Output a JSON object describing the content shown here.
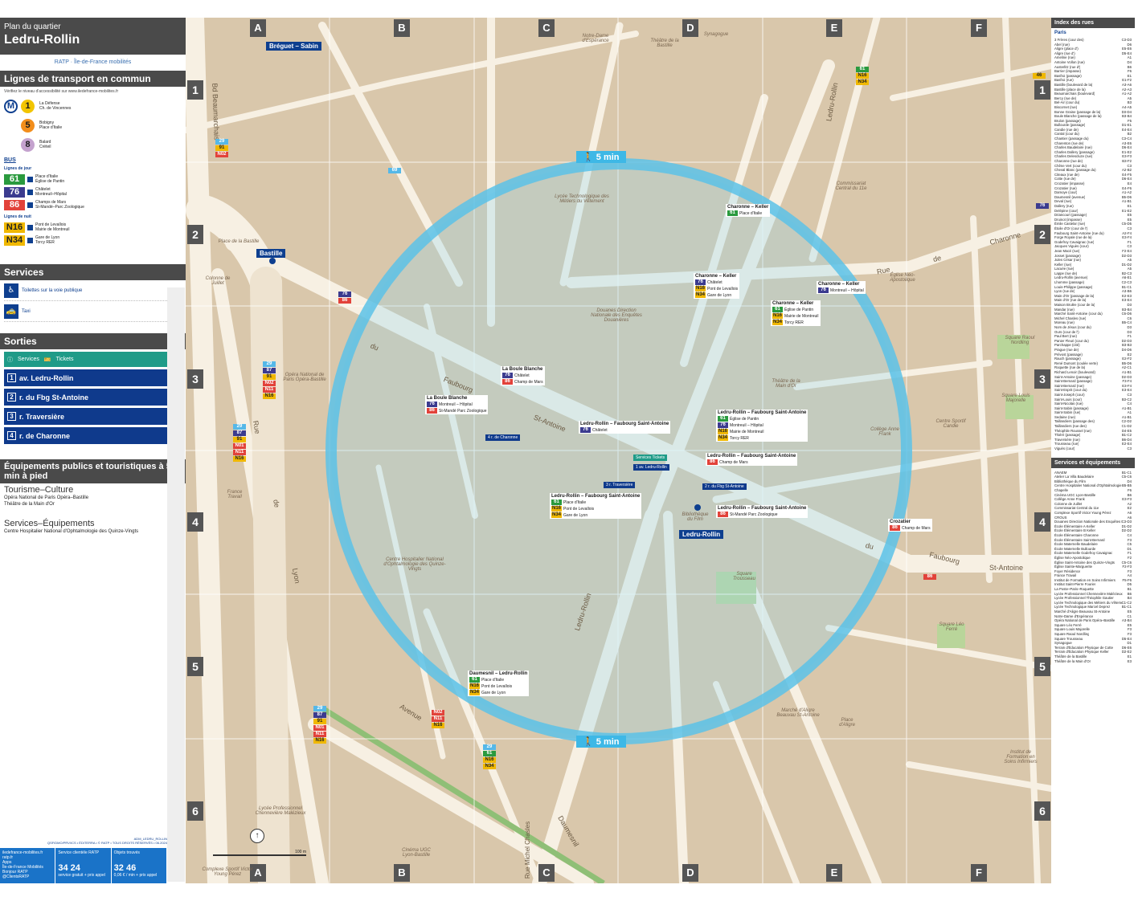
{
  "header": {
    "subtitle": "Plan du quartier",
    "title": "Ledru-Rollin",
    "logos": "RATP · Île-de-France mobilités"
  },
  "transport": {
    "heading": "Lignes de transport en commun",
    "note": "Vérifiez le niveau d'accessibilité sur www.iledefrance-mobilites.fr",
    "metro": [
      {
        "line": "1",
        "color": "#f2c500",
        "dest": [
          "La Défense",
          "Ch. de Vincennes"
        ]
      },
      {
        "line": "5",
        "color": "#f28e1c",
        "dest": [
          "Bobigny",
          "Place d'Italie"
        ]
      },
      {
        "line": "8",
        "color": "#c4a2ce",
        "dest": [
          "Balard",
          "Créteil"
        ]
      }
    ],
    "bus_label": "BUS",
    "day_label": "Lignes de jour",
    "day": [
      {
        "line": "61",
        "color": "#2a9a3e",
        "dest": [
          "Place d'Italie",
          "Église de Pantin"
        ]
      },
      {
        "line": "76",
        "color": "#3b3b8f",
        "dest": [
          "Châtelet",
          "Montreuil–Hôpital"
        ]
      },
      {
        "line": "86",
        "color": "#e2423a",
        "dest": [
          "Champs de Mars",
          "St-Mandé–Parc Zoologique"
        ]
      }
    ],
    "night_label": "Lignes de nuit",
    "night": [
      {
        "line": "N16",
        "color": "#f0b800",
        "dest": [
          "Pont de Levallois",
          "Mairie de Montreuil"
        ]
      },
      {
        "line": "N34",
        "color": "#f0b800",
        "dest": [
          "Gare de Lyon",
          "Torcy RER"
        ]
      }
    ]
  },
  "services": {
    "heading": "Services",
    "items": [
      {
        "label": "Toilettes sur la voie publique",
        "ref": ""
      },
      {
        "label": "Taxi",
        "ref": "A2"
      }
    ]
  },
  "exits": {
    "heading": "Sorties",
    "services_label": "Services",
    "tickets_label": "Tickets",
    "items": [
      {
        "num": "1",
        "label": "av. Ledru-Rollin"
      },
      {
        "num": "2",
        "label": "r. du Fbg St-Antoine"
      },
      {
        "num": "3",
        "label": "r. Traversière"
      },
      {
        "num": "4",
        "label": "r. de Charonne"
      }
    ]
  },
  "equipment": {
    "heading": "Équipements publics et touristiques à 5 min à pied",
    "groups": [
      {
        "title": "Tourisme–Culture",
        "items": [
          "Opéra National de Paris Opéra–Bastille",
          "Théâtre de la Main d'Or"
        ]
      },
      {
        "title": "Services–Équipements",
        "items": [
          "Centre Hospitalier National d'Ophtalmologie des Quinze-Vingts"
        ]
      }
    ]
  },
  "credits": {
    "code": "ADM_LEDRU_ROLLIN",
    "line": "QSF/DMO/PRV/ICS • ÉDITERRA • © RATP • TOUS DROITS RÉSERVÉS • 06.2024"
  },
  "contact": {
    "web": [
      "iledefrance-mobilites.fr",
      "ratp.fr",
      "Apps",
      "Île-de-France Mobilités",
      "Bonjour RATP",
      "@ClientsRATP"
    ],
    "svc_title": "Service clientèle RATP",
    "svc_phone": "34 24",
    "svc_note": "service gratuit + prix appel",
    "lost_title": "Objets trouvés",
    "lost_phone": "32 46",
    "lost_note": "0,06 € / min + prix appel"
  },
  "map": {
    "columns": [
      "A",
      "B",
      "C",
      "D",
      "E",
      "F"
    ],
    "rows": [
      "1",
      "2",
      "3",
      "4",
      "5",
      "6"
    ],
    "walk_label": "5 min",
    "stations": [
      "Bréguet – Sabin",
      "Bastille",
      "Ledru-Rollin"
    ],
    "stops": [
      {
        "name": "Charonne – Keller",
        "lines": [
          {
            "n": "61",
            "c": "#2a9a3e",
            "d": "Place d'Italie"
          }
        ]
      },
      {
        "name": "Charonne – Keller",
        "lines": [
          {
            "n": "76",
            "c": "#3b3b8f",
            "d": "Châtelet"
          },
          {
            "n": "N16",
            "c": "#f0b800",
            "d": "Pont de Levallois"
          },
          {
            "n": "N34",
            "c": "#f0b800",
            "d": "Gare de Lyon"
          }
        ]
      },
      {
        "name": "Charonne – Keller",
        "lines": [
          {
            "n": "61",
            "c": "#2a9a3e",
            "d": "Église de Pantin"
          },
          {
            "n": "N16",
            "c": "#f0b800",
            "d": "Mairie de Montreuil"
          },
          {
            "n": "N34",
            "c": "#f0b800",
            "d": "Torcy RER"
          }
        ]
      },
      {
        "name": "Charonne – Keller",
        "lines": [
          {
            "n": "76",
            "c": "#3b3b8f",
            "d": "Montreuil – Hôpital"
          }
        ]
      },
      {
        "name": "La Boule Blanche",
        "lines": [
          {
            "n": "76",
            "c": "#3b3b8f",
            "d": "Châtelet"
          },
          {
            "n": "86",
            "c": "#e2423a",
            "d": "Champ de Mars"
          }
        ]
      },
      {
        "name": "La Boule Blanche",
        "lines": [
          {
            "n": "76",
            "c": "#3b3b8f",
            "d": "Montreuil – Hôpital"
          },
          {
            "n": "86",
            "c": "#e2423a",
            "d": "St-Mandé Parc Zoologique"
          }
        ]
      },
      {
        "name": "Ledru-Rollin – Faubourg Saint-Antoine",
        "lines": [
          {
            "n": "76",
            "c": "#3b3b8f",
            "d": "Châtelet"
          }
        ]
      },
      {
        "name": "Ledru-Rollin – Faubourg Saint-Antoine",
        "lines": [
          {
            "n": "61",
            "c": "#2a9a3e",
            "d": "Église de Pantin"
          },
          {
            "n": "76",
            "c": "#3b3b8f",
            "d": "Montreuil – Hôpital"
          },
          {
            "n": "N16",
            "c": "#f0b800",
            "d": "Mairie de Montreuil"
          },
          {
            "n": "N34",
            "c": "#f0b800",
            "d": "Torcy RER"
          }
        ]
      },
      {
        "name": "Ledru-Rollin – Faubourg Saint-Antoine",
        "lines": [
          {
            "n": "86",
            "c": "#e2423a",
            "d": "Champ de Mars"
          }
        ]
      },
      {
        "name": "Ledru-Rollin – Faubourg Saint-Antoine",
        "lines": [
          {
            "n": "61",
            "c": "#2a9a3e",
            "d": "Place d'Italie"
          },
          {
            "n": "N16",
            "c": "#f0b800",
            "d": "Pont de Levallois"
          },
          {
            "n": "N34",
            "c": "#f0b800",
            "d": "Gare de Lyon"
          }
        ]
      },
      {
        "name": "Ledru-Rollin – Faubourg Saint-Antoine",
        "lines": [
          {
            "n": "86",
            "c": "#e2423a",
            "d": "St-Mandé Parc Zoologique"
          }
        ]
      },
      {
        "name": "Crozatier",
        "lines": [
          {
            "n": "86",
            "c": "#e2423a",
            "d": "Champ de Mars"
          }
        ]
      },
      {
        "name": "Daumesnil – Ledru-Rollin",
        "lines": [
          {
            "n": "61",
            "c": "#2a9a3e",
            "d": "Place d'Italie"
          },
          {
            "n": "N16",
            "c": "#f0b800",
            "d": "Pont de Levallois"
          },
          {
            "n": "N34",
            "c": "#f0b800",
            "d": "Gare de Lyon"
          }
        ]
      }
    ],
    "exit_tags": [
      "4 r. de Charonne",
      "1 av. Ledru-Rollin",
      "3 r. Traversière",
      "2 r. du Fbg St-Antoine"
    ],
    "exit_services": "Services  Tickets",
    "streets": [
      "Bd Beaumarchais",
      "Faubourg",
      "St-Antoine",
      "du",
      "Rue",
      "de",
      "Lyon",
      "Ledru-Rollin",
      "Avenue",
      "Daumesnil",
      "Charonne",
      "Rue",
      "de",
      "Faubourg",
      "du",
      "St-Antoine",
      "Rue Michel Chasles",
      "Ledru-Rollin"
    ],
    "places": [
      "Place de la Bastille",
      "Colonne de Juillet",
      "Opéra National de Paris Opéra-Bastille",
      "Lycée Technologique des Métiers du Vêtement",
      "Centre Hospitalier National d'Ophtalmologie des Quinze-Vingts",
      "Square Trousseau",
      "Marché d'Aligre Beauvau St-Antoine",
      "Place d'Aligre",
      "Square Léo Ferré",
      "Collège Anne Frank",
      "Théâtre de la Main d'Or",
      "Église Néo-Apostolique",
      "Douanes Direction Nationale des Enquêtes Douanières",
      "Bibliothèque du Film",
      "Lycée Professionnel Chennevière Malézieux",
      "Cinéma UGC Lyon-Bastille",
      "Complexe Sportif Victor Young Pérez",
      "Square Raoul Nordling",
      "Square Louis Majorelle",
      "Centre Sportif Candie",
      "Commissariat Central du 11e",
      "Théâtre de la Bastille",
      "Synagogue",
      "Notre-Dame d'Espérance",
      "Institut de Formation en Soins Infirmiers",
      "France Travail"
    ],
    "margin_buses": [
      {
        "n": "29",
        "c": "#55b8e8"
      },
      {
        "n": "91",
        "c": "#f0b800"
      },
      {
        "n": "N02",
        "c": "#e2423a"
      },
      {
        "n": "69",
        "c": "#55b8e8"
      },
      {
        "n": "46",
        "c": "#f0b800"
      },
      {
        "n": "61",
        "c": "#2a9a3e"
      },
      {
        "n": "N16",
        "c": "#f0b800"
      },
      {
        "n": "N34",
        "c": "#f0b800"
      },
      {
        "n": "76",
        "c": "#3b3b8f"
      },
      {
        "n": "86",
        "c": "#e2423a"
      },
      {
        "n": "87",
        "c": "#3b3b8f"
      },
      {
        "n": "N01",
        "c": "#e2423a"
      },
      {
        "n": "N11",
        "c": "#e2423a"
      }
    ],
    "scale": "100 m"
  },
  "index": {
    "heading": "Index des rues",
    "city": "Paris",
    "streets": [
      [
        "3 Frères (cour des)",
        "C3-D3"
      ],
      [
        "Abel (rue)",
        "D6"
      ],
      [
        "Aligre (place d')",
        "E5-E6"
      ],
      [
        "Aligre (rue d')",
        "D5-E4"
      ],
      [
        "Ameline (rue)",
        "A1"
      ],
      [
        "Antoine Vollon (rue)",
        "D4"
      ],
      [
        "Austerlitz (rue d')",
        "B6"
      ],
      [
        "Barrier (impasse)",
        "F6"
      ],
      [
        "Basfroi (passage)",
        "E1"
      ],
      [
        "Basfroi (rue)",
        "E1-F2"
      ],
      [
        "Bastille (boulevard de la)",
        "A3-A6"
      ],
      [
        "Bastille (place de la)",
        "A2-A3"
      ],
      [
        "Beaumarchais (boulevard)",
        "A1-A2"
      ],
      [
        "Bercy (rue de)",
        "A5"
      ],
      [
        "Bel-Air (cour du)",
        "B3"
      ],
      [
        "Biscornet (rue)",
        "A4-A5"
      ],
      [
        "Bonne Graine (passage de la)",
        "D3-D4"
      ],
      [
        "Boule Blanche (passage de la)",
        "B3-B4"
      ],
      [
        "Brulon (passage)",
        "F5"
      ],
      [
        "Bullourde (passage)",
        "D1-E1"
      ],
      [
        "Candie (rue de)",
        "E4-E4"
      ],
      [
        "Cantal (cour du)",
        "B2"
      ],
      [
        "Chantier (passage du)",
        "C3-C4"
      ],
      [
        "Charenton (rue de)",
        "A3-E6"
      ],
      [
        "Charles Baudelaire (rue)",
        "D6-E4"
      ],
      [
        "Charles Dallery (passage)",
        "E1-E2"
      ],
      [
        "Charles Delescluze (rue)",
        "E3-F3"
      ],
      [
        "Charonne (rue de)",
        "B3-F2"
      ],
      [
        "Chêne Vert (cour du)",
        "C3"
      ],
      [
        "Cheval Blanc (passage du)",
        "A2-B2"
      ],
      [
        "Citeaux (rue de)",
        "E4-F5"
      ],
      [
        "Cotte (rue de)",
        "D6-E4"
      ],
      [
        "Crozatier (impasse)",
        "E4"
      ],
      [
        "Crozatier (rue)",
        "E4-F6"
      ],
      [
        "Damoye (cour)",
        "A1-A2"
      ],
      [
        "Daumesnil (avenue)",
        "B5-D6"
      ],
      [
        "Deval (rue)",
        "A1-B1"
      ],
      [
        "Dallery (rue)",
        "E1"
      ],
      [
        "Delépine (cour)",
        "E1-E2"
      ],
      [
        "Driancourt (passage)",
        "E5"
      ],
      [
        "Druinot (impasse)",
        "E5"
      ],
      [
        "Émile Castelar (rue)",
        "C5-D5"
      ],
      [
        "Étoile d'Or (cour de l')",
        "C3"
      ],
      [
        "Faubourg Saint-Antoine (rue du)",
        "A2-F4"
      ],
      [
        "Forge Royale (rue de la)",
        "E3-F4"
      ],
      [
        "Godefroy Cavaignac (rue)",
        "F1"
      ],
      [
        "Jacques Viguès (cour)",
        "C3"
      ],
      [
        "Jean Macé (rue)",
        "F2-E4"
      ],
      [
        "Josset (passage)",
        "D2-D3"
      ],
      [
        "Jules César (rue)",
        "A5"
      ],
      [
        "Keller (rue)",
        "D1-D2"
      ],
      [
        "Lacuée (rue)",
        "A5"
      ],
      [
        "Lappe (rue de)",
        "B2-C3"
      ],
      [
        "Ledru-Rollin (avenue)",
        "A6-E1"
      ],
      [
        "Lhomme (passage)",
        "C2-C3"
      ],
      [
        "Louis-Philippe (passage)",
        "B1-C1"
      ],
      [
        "Lyon (rue de)",
        "A3-B6"
      ],
      [
        "Main d'Or (passage de la)",
        "E2-E3"
      ],
      [
        "Main d'Or (rue de la)",
        "E3-E4"
      ],
      [
        "Maison Brulée (cour de la)",
        "D3"
      ],
      [
        "Mandar (rue)",
        "B3-B4"
      ],
      [
        "Marché Saint-Antoine (cour du)",
        "C6-D6"
      ],
      [
        "Michel Chasles (rue)",
        "C6"
      ],
      [
        "Moreau (rue)",
        "B5-C4"
      ],
      [
        "Nom de Jésus (cour du)",
        "D3"
      ],
      [
        "Ours (cour de l')",
        "D3"
      ],
      [
        "Paul Bert (rue)",
        "F1"
      ],
      [
        "Panier Fleuri (cour du)",
        "D2-D3"
      ],
      [
        "Parchappe (cité)",
        "B3-B3"
      ],
      [
        "Prague (rue de)",
        "D4-D6"
      ],
      [
        "Prévost (passage)",
        "E2"
      ],
      [
        "Rauch (passage)",
        "E2-F2"
      ],
      [
        "René Dumont (coulée verte)",
        "B5-D6"
      ],
      [
        "Roquette (rue de la)",
        "A2-C1"
      ],
      [
        "Richard Lenoir (boulevard)",
        "A1-B1"
      ],
      [
        "Saint-Antoine (passage)",
        "D2-D3"
      ],
      [
        "Saint-Bernard (passage)",
        "F3-F4"
      ],
      [
        "Saint-Bernard (rue)",
        "E3-F4"
      ],
      [
        "Saint-Esprit (cour du)",
        "E3-E4"
      ],
      [
        "Saint-Joseph (cour)",
        "C3"
      ],
      [
        "Saint-Louis (cour)",
        "B3-C2"
      ],
      [
        "Saint-Nicolas (rue)",
        "C4"
      ],
      [
        "Saint-Sabin (passage)",
        "A1-B1"
      ],
      [
        "Saint-Sabin (rue)",
        "A1"
      ],
      [
        "Sedaine (rue)",
        "A1-B1"
      ],
      [
        "Taillandiers (passage des)",
        "C2-D2"
      ],
      [
        "Taillandiers (rue des)",
        "C1-D2"
      ],
      [
        "Théophile Roussel (rue)",
        "D4-E5"
      ],
      [
        "Thiéré (passage)",
        "B1-C2"
      ],
      [
        "Traversière (rue)",
        "B6-D4"
      ],
      [
        "Trousseau (rue)",
        "E2-E4"
      ],
      [
        "Viguès (cour)",
        "C3"
      ]
    ],
    "equip_heading": "Services et équipements",
    "equip": [
      [
        "ANAEM",
        "B1-C1"
      ],
      [
        "Atelier La Villa Baudelaire",
        "C5-C6"
      ],
      [
        "Bibliothèque du Film",
        "D4"
      ],
      [
        "Centre Hospitalier National d'Ophtalmologie des Quinze-Vingts",
        "B5-B5"
      ],
      [
        "Chapelle",
        "F6"
      ],
      [
        "Cinéma UGC Lyon-Bastille",
        "B6"
      ],
      [
        "Collège Anne Frank",
        "E3-F3"
      ],
      [
        "Colonne de Juillet",
        "A2"
      ],
      [
        "Commissariat Central du 11e",
        "E2"
      ],
      [
        "Complexe Sportif Victor Young Pérez",
        "A6"
      ],
      [
        "CROUS",
        "A6"
      ],
      [
        "Douanes Direction Nationale des Enquêtes Douanières",
        "C3-D3"
      ],
      [
        "École Élémentaire A Keller",
        "D1-D2"
      ],
      [
        "École Élémentaire B Keller",
        "D2-D2"
      ],
      [
        "École Élémentaire Charonne",
        "C4"
      ],
      [
        "École Élémentaire Saint-Bernard",
        "F3"
      ],
      [
        "École Maternelle Baudelaire",
        "C5"
      ],
      [
        "École Maternelle Bullourde",
        "D1"
      ],
      [
        "École Maternelle Godefroy Cavaignac",
        "F1"
      ],
      [
        "Église Néo-Apostolique",
        "F2"
      ],
      [
        "Église Saint-Antoine des Quinze-Vingts",
        "C5-C6"
      ],
      [
        "Église Sainte-Marguerite",
        "F2-F3"
      ],
      [
        "Foyer Résidence",
        "F3"
      ],
      [
        "France Travail",
        "A4"
      ],
      [
        "Institut de Formation en Soins Infirmiers",
        "F5-F6"
      ],
      [
        "Institut Saint-Pierre Fourier",
        "D5"
      ],
      [
        "La Poste–Paris–Roquette",
        "B1"
      ],
      [
        "Lycée Professionnel Chennevière Malézieux",
        "B6"
      ],
      [
        "Lycée Professionnel Théophile Gautier",
        "B4"
      ],
      [
        "Lycée Technologique des Métiers du Vêtement",
        "C1-C2"
      ],
      [
        "Lycée Technologique Marcel Deprez",
        "B1-C1"
      ],
      [
        "Marché d'Aligre Beauvau St-Antoine",
        "E5"
      ],
      [
        "Notre-Dame d'Espérance",
        "C1"
      ],
      [
        "Opéra National de Paris Opéra–Bastille",
        "A3-B4"
      ],
      [
        "Square Léo Ferré",
        "E5"
      ],
      [
        "Square Louis Majorelle",
        "F3"
      ],
      [
        "Square Raoul Nordling",
        "F3"
      ],
      [
        "Square Trousseau",
        "D5-E4"
      ],
      [
        "Synagogue",
        "D1"
      ],
      [
        "Terrain d'Éducation Physique de Cotte",
        "D6-E6"
      ],
      [
        "Terrain d'Éducation Physique Keller",
        "D2-E2"
      ],
      [
        "Théâtre de la Bastille",
        "E1"
      ],
      [
        "Théâtre de la Main d'Or",
        "E3"
      ]
    ]
  }
}
